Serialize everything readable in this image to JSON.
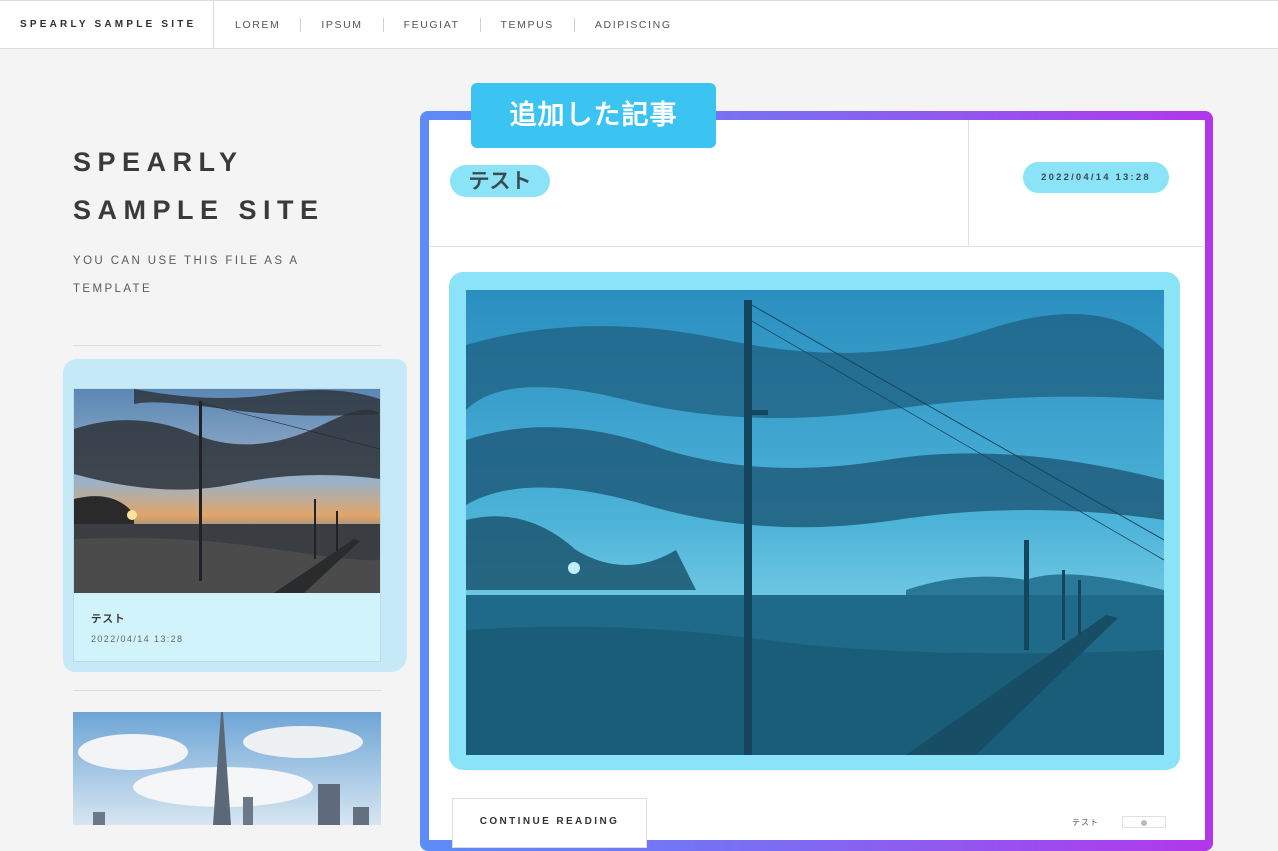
{
  "topbar": {
    "brand": "SPEARLY SAMPLE SITE",
    "nav": [
      "LOREM",
      "IPSUM",
      "FEUGIAT",
      "TEMPUS",
      "ADIPISCING"
    ]
  },
  "sidebar": {
    "site_title_line1": "SPEARLY",
    "site_title_line2": "SAMPLE SITE",
    "description": "YOU CAN USE THIS FILE AS A TEMPLATE",
    "posts": [
      {
        "title": "テスト",
        "date": "2022/04/14 13:28",
        "image": "sunset-pier-photo"
      },
      {
        "image": "city-skyline-photo"
      }
    ]
  },
  "annotation": {
    "label": "追加した記事",
    "color": "#3bc3f1"
  },
  "article": {
    "title": "テスト",
    "date": "2022/04/14 13:28",
    "image": "sunset-pier-photo",
    "continue_label": "CONTINUE READING",
    "author": "テスト"
  },
  "colors": {
    "highlight": "#8ae3f7",
    "frame_gradient_start": "#5b8cf7",
    "frame_gradient_end": "#b237ea"
  }
}
